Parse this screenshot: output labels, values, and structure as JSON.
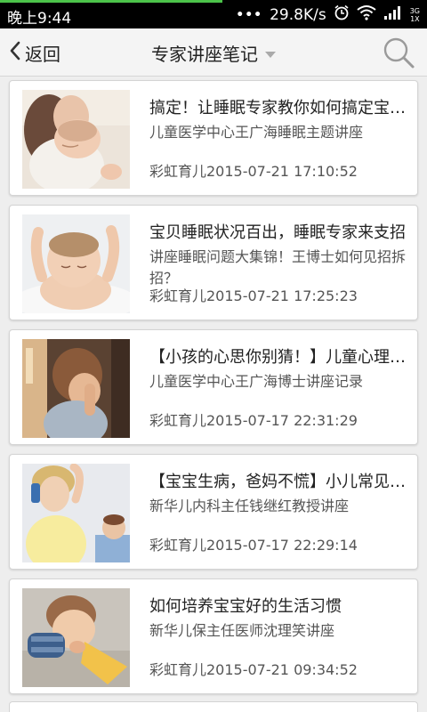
{
  "status_bar": {
    "time": "晚上9:44",
    "network_speed": "29.8K/s",
    "network_type_top": "3G",
    "network_type_bottom": "1X",
    "icons": [
      "alarm-icon",
      "wifi-icon",
      "signal-icon"
    ]
  },
  "header": {
    "back_label": "返回",
    "title": "专家讲座笔记",
    "search_icon": "search-icon"
  },
  "items": [
    {
      "title": "搞定！让睡眠专家教你如何搞定宝宝睡眠",
      "subtitle": "儿童医学中心王广海睡眠主题讲座",
      "meta": "彩虹育儿2015-07-21 17:10:52",
      "thumbnail": "mother-holding-sleeping-baby"
    },
    {
      "title": "宝贝睡眠状况百出，睡眠专家来支招",
      "subtitle": "讲座睡眠问题大集锦！王博士如何见招拆招？",
      "meta": "彩虹育儿2015-07-21 17:25:23",
      "thumbnail": "sleeping-baby-arms-up"
    },
    {
      "title": "【小孩的心思你别猜！】儿童心理讲座",
      "subtitle": "儿童医学中心王广海博士讲座记录",
      "meta": "彩虹育儿2015-07-17 22:31:29",
      "thumbnail": "child-covering-face"
    },
    {
      "title": "【宝宝生病，爸妈不慌】小儿常见病讲座",
      "subtitle": "新华儿内科主任钱继红教授讲座",
      "meta": "彩虹育儿2015-07-17 22:29:14",
      "thumbnail": "worried-mother-on-phone"
    },
    {
      "title": "如何培养宝宝好的生活习惯",
      "subtitle": "新华儿保主任医师沈理笑讲座",
      "meta": "彩虹育儿2015-07-21 09:34:52",
      "thumbnail": "baby-chewing-cloth"
    }
  ],
  "colors": {
    "status_bar_bg": "#000000",
    "progress_accent": "#4cc34a",
    "header_bg": "#f4f4f4",
    "list_bg": "#eeeeee",
    "card_bg": "#ffffff"
  }
}
